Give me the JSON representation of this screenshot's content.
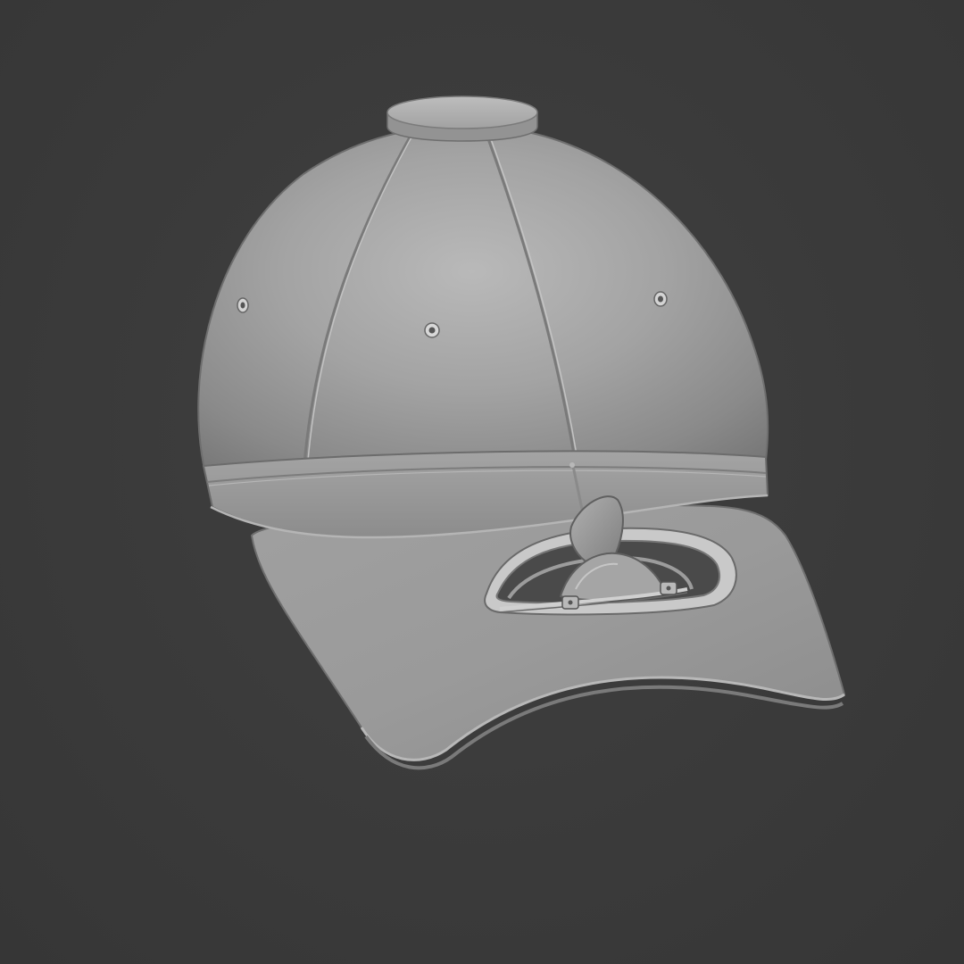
{
  "scene": {
    "background_color": "#3b3b3b",
    "model": {
      "subject": "baseball-cap",
      "material_color": "#9a9a9a",
      "features": [
        "crown-panels",
        "top-button",
        "eyelets",
        "headband-seam",
        "brim",
        "brim-handle-cutout",
        "bottle-opener-hinge"
      ]
    }
  }
}
